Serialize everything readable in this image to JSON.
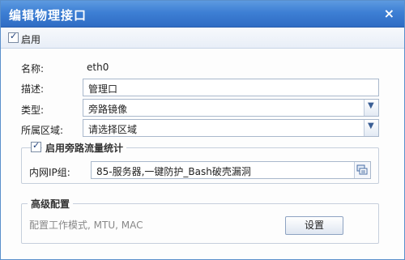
{
  "dialog": {
    "title": "编辑物理接口",
    "close_glyph": "×"
  },
  "enable": {
    "label": "启用",
    "checked": true
  },
  "form": {
    "name_label": "名称:",
    "name_value": "eth0",
    "desc_label": "描述:",
    "desc_value": "管理口",
    "type_label": "类型:",
    "type_value": "旁路镜像",
    "zone_label": "所属区域:",
    "zone_value": "请选择区域"
  },
  "bypass_stats": {
    "label": "启用旁路流量统计",
    "checked": true,
    "ip_group_label": "内网IP组:",
    "ip_group_value": "85-服务器,一键防护_Bash破壳漏洞"
  },
  "advanced": {
    "legend": "高级配置",
    "hint": "配置工作模式, MTU, MAC",
    "button_label": "设置"
  },
  "colors": {
    "titlebar": "#3d7fd4",
    "accent": "#2f6cc4"
  }
}
